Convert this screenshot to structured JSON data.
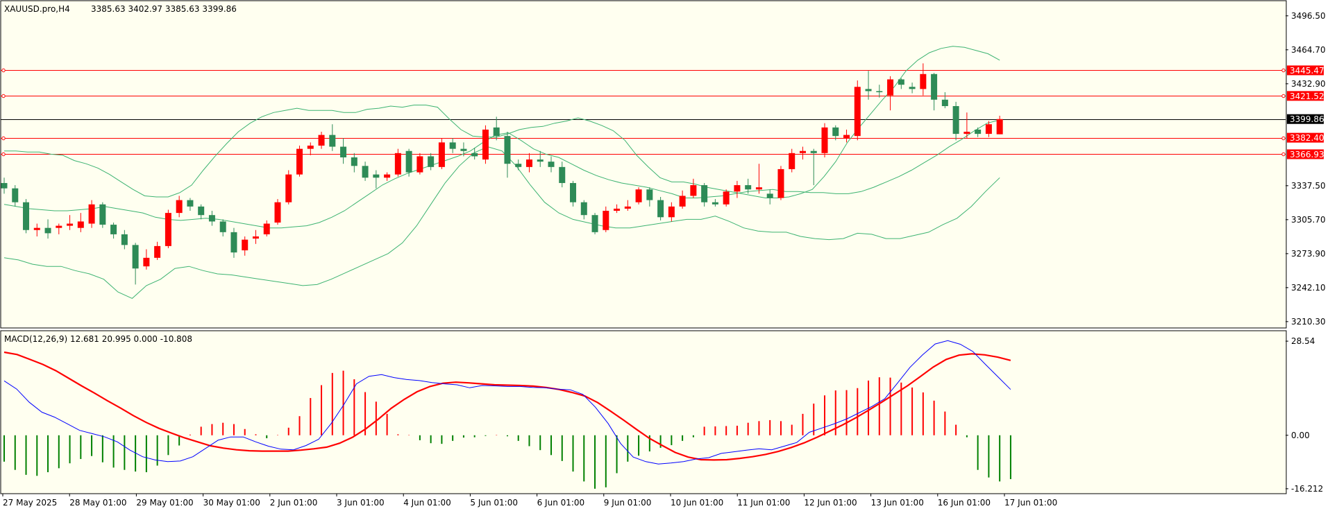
{
  "chart_data": [
    {
      "type": "candlestick",
      "title": "XAUUSD.pro,H4",
      "ohlc_header": "3385.63 3402.97 3385.63 3399.86",
      "ylim": [
        3205,
        3510
      ],
      "yticks": [
        "3496.50",
        "3464.70",
        "3432.90",
        "3337.50",
        "3305.70",
        "3273.90",
        "3242.10",
        "3210.30"
      ],
      "xlabels": [
        "27 May 2025",
        "28 May 01:00",
        "29 May 01:00",
        "30 May 01:00",
        "2 Jun 01:00",
        "3 Jun 01:00",
        "4 Jun 01:00",
        "5 Jun 01:00",
        "6 Jun 01:00",
        "9 Jun 01:00",
        "10 Jun 01:00",
        "11 Jun 01:00",
        "12 Jun 01:00",
        "13 Jun 01:00",
        "16 Jun 01:00",
        "17 Jun 01:00"
      ],
      "levels": [
        {
          "label": "3445.47",
          "value": 3445.47,
          "color": "#ff0000"
        },
        {
          "label": "3421.52",
          "value": 3421.52,
          "color": "#ff0000"
        },
        {
          "label": "3399.86",
          "value": 3399.86,
          "color": "#000000"
        },
        {
          "label": "3382.40",
          "value": 3382.4,
          "color": "#ff0000"
        },
        {
          "label": "3366.93",
          "value": 3366.93,
          "color": "#ff0000"
        }
      ],
      "candles": [
        [
          3340,
          3345,
          3330,
          3335
        ],
        [
          3335,
          3338,
          3318,
          3322
        ],
        [
          3322,
          3325,
          3293,
          3296
        ],
        [
          3296,
          3302,
          3290,
          3298
        ],
        [
          3298,
          3306,
          3288,
          3293
        ],
        [
          3298,
          3302,
          3292,
          3300
        ],
        [
          3300,
          3310,
          3296,
          3302
        ],
        [
          3298,
          3312,
          3294,
          3304
        ],
        [
          3302,
          3324,
          3298,
          3320
        ],
        [
          3320,
          3322,
          3298,
          3301
        ],
        [
          3301,
          3303,
          3288,
          3292
        ],
        [
          3292,
          3296,
          3278,
          3282
        ],
        [
          3282,
          3284,
          3245,
          3260
        ],
        [
          3262,
          3278,
          3259,
          3270
        ],
        [
          3270,
          3285,
          3268,
          3281
        ],
        [
          3281,
          3315,
          3279,
          3312
        ],
        [
          3312,
          3328,
          3308,
          3324
        ],
        [
          3324,
          3326,
          3314,
          3318
        ],
        [
          3318,
          3320,
          3306,
          3310
        ],
        [
          3310,
          3314,
          3300,
          3304
        ],
        [
          3304,
          3306,
          3290,
          3294
        ],
        [
          3294,
          3298,
          3270,
          3275
        ],
        [
          3277,
          3290,
          3272,
          3287
        ],
        [
          3288,
          3296,
          3283,
          3290
        ],
        [
          3292,
          3305,
          3290,
          3302
        ],
        [
          3303,
          3325,
          3301,
          3322
        ],
        [
          3322,
          3352,
          3320,
          3348
        ],
        [
          3348,
          3375,
          3346,
          3372
        ],
        [
          3372,
          3378,
          3366,
          3375
        ],
        [
          3375,
          3388,
          3372,
          3385
        ],
        [
          3385,
          3395,
          3370,
          3374
        ],
        [
          3374,
          3382,
          3358,
          3364
        ],
        [
          3364,
          3368,
          3350,
          3356
        ],
        [
          3356,
          3360,
          3342,
          3345
        ],
        [
          3348,
          3352,
          3335,
          3345
        ],
        [
          3345,
          3350,
          3342,
          3348
        ],
        [
          3348,
          3372,
          3346,
          3368
        ],
        [
          3370,
          3372,
          3346,
          3350
        ],
        [
          3350,
          3368,
          3348,
          3365
        ],
        [
          3365,
          3368,
          3352,
          3355
        ],
        [
          3355,
          3382,
          3353,
          3378
        ],
        [
          3378,
          3382,
          3368,
          3372
        ],
        [
          3372,
          3378,
          3365,
          3370
        ],
        [
          3368,
          3373,
          3362,
          3365
        ],
        [
          3362,
          3394,
          3358,
          3390
        ],
        [
          3392,
          3402,
          3380,
          3384
        ],
        [
          3384,
          3388,
          3345,
          3358
        ],
        [
          3358,
          3362,
          3352,
          3355
        ],
        [
          3355,
          3368,
          3350,
          3362
        ],
        [
          3362,
          3370,
          3355,
          3360
        ],
        [
          3360,
          3365,
          3350,
          3355
        ],
        [
          3355,
          3360,
          3336,
          3340
        ],
        [
          3340,
          3342,
          3318,
          3322
        ],
        [
          3322,
          3324,
          3306,
          3310
        ],
        [
          3310,
          3312,
          3292,
          3294
        ],
        [
          3296,
          3318,
          3294,
          3314
        ],
        [
          3314,
          3320,
          3312,
          3316
        ],
        [
          3316,
          3324,
          3314,
          3318
        ],
        [
          3322,
          3336,
          3320,
          3334
        ],
        [
          3334,
          3336,
          3318,
          3324
        ],
        [
          3324,
          3327,
          3305,
          3308
        ],
        [
          3308,
          3322,
          3304,
          3318
        ],
        [
          3318,
          3333,
          3316,
          3328
        ],
        [
          3328,
          3344,
          3326,
          3338
        ],
        [
          3338,
          3340,
          3318,
          3322
        ],
        [
          3322,
          3325,
          3318,
          3320
        ],
        [
          3320,
          3334,
          3318,
          3332
        ],
        [
          3332,
          3342,
          3326,
          3338
        ],
        [
          3338,
          3344,
          3330,
          3334
        ],
        [
          3334,
          3358,
          3330,
          3336
        ],
        [
          3330,
          3334,
          3320,
          3326
        ],
        [
          3326,
          3356,
          3324,
          3353
        ],
        [
          3353,
          3372,
          3350,
          3368
        ],
        [
          3368,
          3374,
          3362,
          3370
        ],
        [
          3370,
          3372,
          3338,
          3368
        ],
        [
          3368,
          3396,
          3364,
          3392
        ],
        [
          3392,
          3394,
          3380,
          3384
        ],
        [
          3382,
          3390,
          3378,
          3385
        ],
        [
          3384,
          3436,
          3380,
          3430
        ],
        [
          3428,
          3445,
          3418,
          3426
        ],
        [
          3426,
          3432,
          3420,
          3425
        ],
        [
          3422,
          3440,
          3408,
          3437
        ],
        [
          3437,
          3438,
          3428,
          3432
        ],
        [
          3430,
          3434,
          3424,
          3428
        ],
        [
          3428,
          3452,
          3422,
          3442
        ],
        [
          3442,
          3443,
          3408,
          3418
        ],
        [
          3418,
          3425,
          3410,
          3412
        ],
        [
          3412,
          3416,
          3380,
          3386
        ],
        [
          3386,
          3406,
          3382,
          3388
        ],
        [
          3390,
          3392,
          3383,
          3386
        ],
        [
          3386,
          3398,
          3383,
          3395
        ],
        [
          3385.63,
          3402.97,
          3385.63,
          3399.86
        ]
      ],
      "bollinger": {
        "upper": [
          3370,
          3370,
          3369,
          3369,
          3367,
          3366,
          3361,
          3358,
          3354,
          3348,
          3341,
          3334,
          3328,
          3327,
          3327,
          3331,
          3338,
          3352,
          3365,
          3377,
          3388,
          3396,
          3402,
          3406,
          3408,
          3410,
          3408,
          3408,
          3408,
          3406,
          3406,
          3409,
          3410,
          3412,
          3411,
          3413,
          3413,
          3411,
          3400,
          3390,
          3384,
          3383,
          3383,
          3386,
          3390,
          3392,
          3393,
          3396,
          3398,
          3401,
          3398,
          3394,
          3389,
          3380,
          3366,
          3355,
          3345,
          3341,
          3341,
          3339,
          3336,
          3334,
          3332,
          3330,
          3328,
          3326,
          3326,
          3327,
          3330,
          3334,
          3346,
          3360,
          3378,
          3392,
          3405,
          3418,
          3430,
          3445,
          3455,
          3462,
          3466,
          3468,
          3467,
          3464,
          3461,
          3455
        ],
        "middle": [
          3320,
          3318,
          3316,
          3315,
          3314,
          3314,
          3315,
          3316,
          3318,
          3316,
          3314,
          3312,
          3308,
          3306,
          3305,
          3306,
          3307,
          3306,
          3304,
          3302,
          3300,
          3298,
          3298,
          3299,
          3300,
          3303,
          3308,
          3314,
          3322,
          3330,
          3338,
          3344,
          3349,
          3353,
          3357,
          3361,
          3365,
          3370,
          3378,
          3385,
          3387,
          3380,
          3372,
          3367,
          3364,
          3358,
          3352,
          3347,
          3343,
          3340,
          3338,
          3336,
          3333,
          3330,
          3326,
          3326,
          3327,
          3328,
          3330,
          3332,
          3333,
          3334,
          3332,
          3332,
          3331,
          3331,
          3330,
          3330,
          3332,
          3336,
          3341,
          3346,
          3352,
          3359,
          3366,
          3374,
          3381,
          3389,
          3396,
          3399
        ],
        "lower": [
          3270,
          3268,
          3264,
          3262,
          3262,
          3258,
          3255,
          3250,
          3238,
          3232,
          3244,
          3250,
          3260,
          3262,
          3258,
          3255,
          3254,
          3252,
          3250,
          3248,
          3246,
          3244,
          3245,
          3250,
          3256,
          3262,
          3268,
          3274,
          3284,
          3300,
          3320,
          3340,
          3356,
          3368,
          3374,
          3370,
          3356,
          3338,
          3322,
          3312,
          3306,
          3303,
          3300,
          3298,
          3298,
          3300,
          3302,
          3304,
          3306,
          3306,
          3309,
          3304,
          3298,
          3295,
          3294,
          3294,
          3290,
          3288,
          3287,
          3288,
          3293,
          3292,
          3288,
          3288,
          3291,
          3294,
          3301,
          3307,
          3318,
          3332,
          3345
        ],
        "color": "#3cb371"
      }
    },
    {
      "type": "macd",
      "title": "MACD(12,26,9) 12.681 20.995 0.000 -10.808",
      "ylim": [
        -17.5,
        31.5
      ],
      "yticks": [
        "28.54",
        "0.00",
        "-16.212"
      ],
      "histogram": [
        -8,
        -10.5,
        -12,
        -12.3,
        -11.2,
        -10,
        -8.5,
        -7.2,
        -6.3,
        -8.2,
        -9.8,
        -10.5,
        -11,
        -11.2,
        -9.2,
        -6,
        -3.1,
        0.2,
        2.6,
        3.4,
        3.8,
        3.4,
        1.9,
        0.3,
        -0.9,
        0.1,
        2.3,
        5.8,
        11.3,
        15.2,
        18.9,
        19.6,
        17,
        13.1,
        10.2,
        6.5,
        0.3,
        0.1,
        -1.5,
        -2.4,
        -2.6,
        -1.7,
        -0.7,
        -0.6,
        -0.2,
        0.1,
        -0.3,
        -1.7,
        -3.3,
        -4.5,
        -6,
        -7.8,
        -11,
        -14,
        -16.2,
        -15.8,
        -11.5,
        -8,
        -6.2,
        -4.9,
        -3.8,
        -3,
        -1.7,
        -0.6,
        2.6,
        2.7,
        2.8,
        2.9,
        3.8,
        4.3,
        4.6,
        4.3,
        3.2,
        6.5,
        9.6,
        12.1,
        13.6,
        13.7,
        14.3,
        16.6,
        17.6,
        17.5,
        16,
        14.5,
        13,
        10.5,
        7.2,
        3.2,
        -0.6,
        -10.5,
        -12.8,
        -14,
        -13.3
      ],
      "signal": [
        25.2,
        24.5,
        23,
        21.5,
        19.6,
        17.3,
        15,
        12.8,
        10.5,
        8.3,
        6,
        3.9,
        2.1,
        0.6,
        -0.8,
        -2,
        -3.2,
        -3.9,
        -4.4,
        -4.7,
        -4.8,
        -4.8,
        -4.8,
        -4.5,
        -4.1,
        -3.6,
        -2.4,
        -0.6,
        1.9,
        4.9,
        8.2,
        10.9,
        13.2,
        14.8,
        15.8,
        16.1,
        15.9,
        15.6,
        15.3,
        15.2,
        15.1,
        14.9,
        14.5,
        13.9,
        13,
        11.9,
        9.9,
        7.3,
        4.6,
        1.8,
        -0.9,
        -3.1,
        -5.2,
        -6.6,
        -7.4,
        -7.5,
        -7.4,
        -7,
        -6.5,
        -5.8,
        -4.9,
        -3.7,
        -2.3,
        -0.6,
        1.3,
        3.2,
        5.3,
        7.6,
        10,
        12.5,
        15,
        17.8,
        20.7,
        23,
        24.3,
        24.7,
        24.4,
        23.7,
        22.7
      ],
      "macd": [
        16.5,
        14,
        10,
        7,
        5.5,
        3.5,
        1.5,
        0.5,
        -0.5,
        -2,
        -4.5,
        -6.5,
        -7.5,
        -8,
        -7.8,
        -6.5,
        -4,
        -1.5,
        -0.5,
        -0.5,
        -2,
        -3.3,
        -4.2,
        -4.4,
        -3.1,
        -1.2,
        3.6,
        9.3,
        15.6,
        17.9,
        18.4,
        17.5,
        16.9,
        16.6,
        16,
        15.6,
        15.3,
        14.4,
        15.1,
        15,
        14.8,
        14.8,
        14.5,
        14.4,
        14,
        13.8,
        12.4,
        8.5,
        3.6,
        -2.5,
        -6.6,
        -8,
        -8.7,
        -8.4,
        -8,
        -7.2,
        -6.8,
        -5.5,
        -5,
        -4.5,
        -4.1,
        -4.4,
        -3.3,
        -2.2,
        0.9,
        2.2,
        3.5,
        5,
        6.9,
        8.8,
        11.1,
        15.8,
        20.6,
        24.4,
        27.7,
        28.7,
        27.6,
        25.4,
        21.5,
        17.7,
        13.9
      ],
      "colors": {
        "hist_pos": "#ff0000",
        "hist_neg": "#008000",
        "signal": "#ff0000",
        "macd": "#0000ff"
      }
    }
  ]
}
